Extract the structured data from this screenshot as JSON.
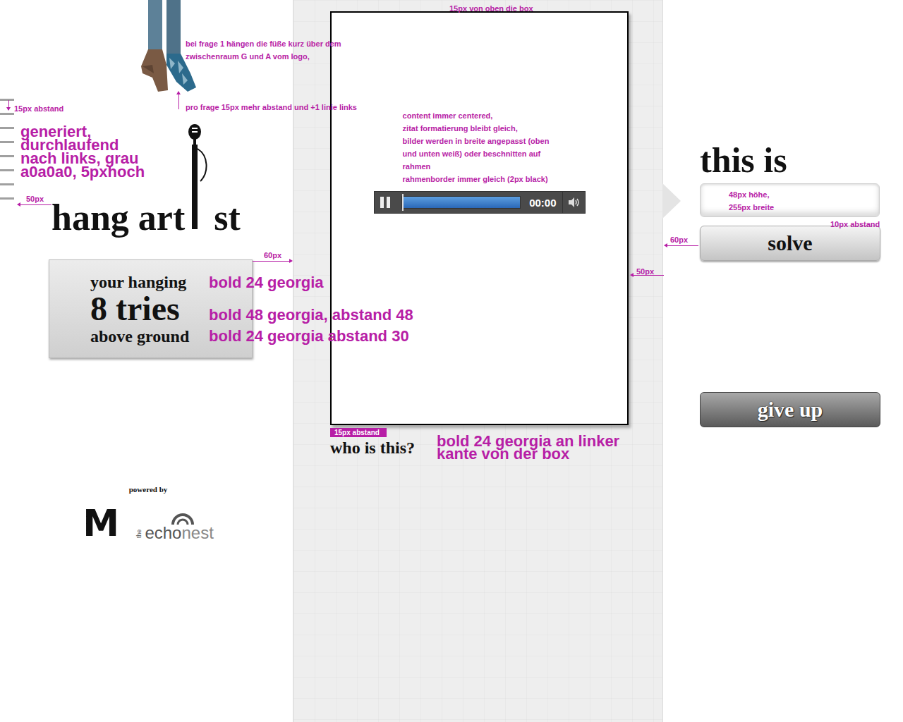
{
  "feet_notes": [
    "bei frage 1 hängen die füße kurz über dem",
    "zwischenraum G und A vom logo,"
  ],
  "feet_spacing_note": "pro frage 15px mehr abstand und +1 linie links",
  "rope": {
    "lines": 8,
    "spacing_note": "15px abstand",
    "note": [
      "generiert,",
      "durchlaufend",
      "nach links, grau",
      "a0a0a0, 5pxhoch"
    ],
    "margin_note": "50px"
  },
  "logo": {
    "before": "hang art",
    "after": "st"
  },
  "tries_box": {
    "margin_note": "60px",
    "lines": [
      {
        "text": "your hanging",
        "note": "bold 24 georgia",
        "kind": "small"
      },
      {
        "text": "8 tries",
        "note": "bold 48 georgia, abstand 48",
        "kind": "big"
      },
      {
        "text": "above ground",
        "note": "bold 24 georgia abstand 30",
        "kind": "bottom"
      }
    ]
  },
  "powered_by": {
    "label": "powered by",
    "m_logo": "M",
    "echonest": {
      "the": "the",
      "echo": "echo",
      "nest": "nest"
    }
  },
  "question_box": {
    "top_note": "15px von oben die box",
    "content_notes": [
      "content immer centered,",
      "zitat formatierung bleibt gleich,",
      "bilder werden in breite angepasst (oben",
      "und unten weiß) oder beschnitten auf",
      "rahmen",
      "rahmenborder immer gleich (2px black)"
    ],
    "player": {
      "playing": true,
      "time": "00:00",
      "level": 0,
      "muted": false
    },
    "side_note": "50px",
    "gap_note": "15px abstand",
    "question": "who is this?",
    "question_note": [
      "bold 24 georgia an linker",
      "kante von der box"
    ]
  },
  "answer": {
    "heading": "this is",
    "input": {
      "value": "",
      "notes": [
        "48px höhe,",
        "255px breite"
      ]
    },
    "gap_note": "10px abstand",
    "margin_note": "60px",
    "solve": "solve",
    "give_up": "give up"
  }
}
